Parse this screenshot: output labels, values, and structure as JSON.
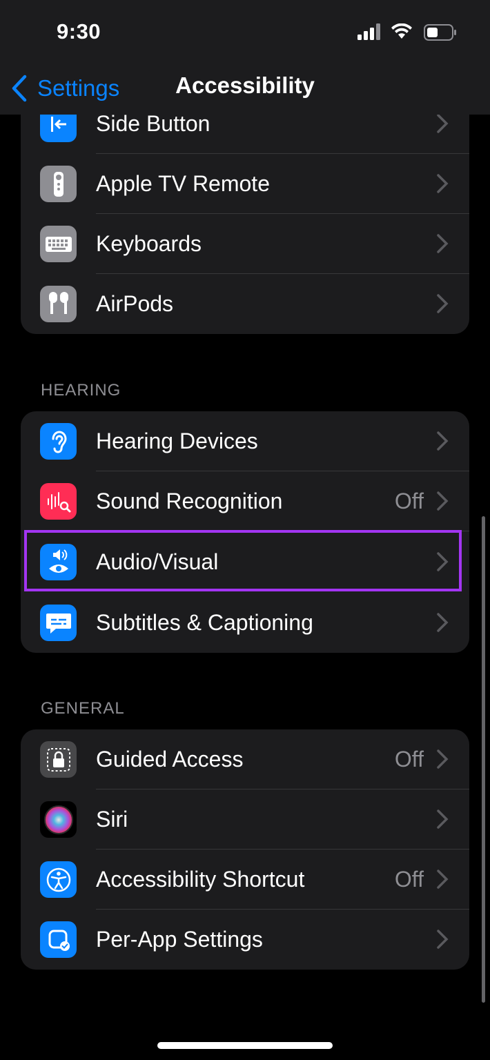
{
  "status_bar": {
    "time": "9:30"
  },
  "nav": {
    "back_label": "Settings",
    "title": "Accessibility"
  },
  "top_group": {
    "items": [
      {
        "label": "Side Button",
        "value": "",
        "icon": "side-button-icon",
        "icon_color": "#0a84ff"
      },
      {
        "label": "Apple TV Remote",
        "value": "",
        "icon": "tv-remote-icon",
        "icon_color": "#8e8e93"
      },
      {
        "label": "Keyboards",
        "value": "",
        "icon": "keyboard-icon",
        "icon_color": "#8e8e93"
      },
      {
        "label": "AirPods",
        "value": "",
        "icon": "airpods-icon",
        "icon_color": "#8e8e93"
      }
    ]
  },
  "hearing": {
    "header": "HEARING",
    "items": [
      {
        "label": "Hearing Devices",
        "value": "",
        "icon": "ear-icon",
        "icon_color": "#0a84ff"
      },
      {
        "label": "Sound Recognition",
        "value": "Off",
        "icon": "waveform-search-icon",
        "icon_color": "#ff2d55"
      },
      {
        "label": "Audio/Visual",
        "value": "",
        "icon": "speaker-eye-icon",
        "icon_color": "#0a84ff"
      },
      {
        "label": "Subtitles & Captioning",
        "value": "",
        "icon": "caption-bubble-icon",
        "icon_color": "#0a84ff"
      }
    ]
  },
  "general": {
    "header": "GENERAL",
    "items": [
      {
        "label": "Guided Access",
        "value": "Off",
        "icon": "lock-frame-icon",
        "icon_color": "#48484a"
      },
      {
        "label": "Siri",
        "value": "",
        "icon": "siri-icon",
        "icon_color": "#000000"
      },
      {
        "label": "Accessibility Shortcut",
        "value": "Off",
        "icon": "accessibility-icon",
        "icon_color": "#0a84ff"
      },
      {
        "label": "Per-App Settings",
        "value": "",
        "icon": "app-check-icon",
        "icon_color": "#0a84ff"
      }
    ]
  },
  "highlight_color": "#a335f2"
}
